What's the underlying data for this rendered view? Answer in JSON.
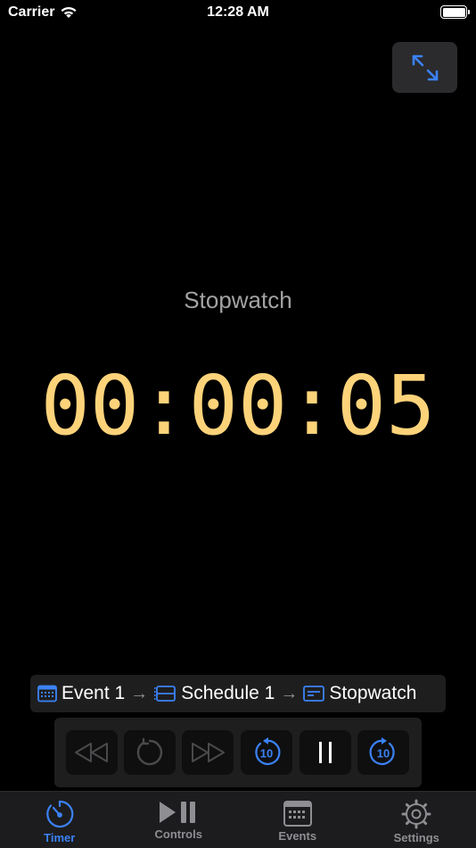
{
  "status_bar": {
    "carrier": "Carrier",
    "time": "12:28 AM"
  },
  "timer": {
    "mode": "Stopwatch",
    "display": "00:00:05"
  },
  "breadcrumb": {
    "event": "Event 1",
    "schedule": "Schedule 1",
    "timer": "Stopwatch"
  },
  "controls": {
    "skip_back_label": "10",
    "skip_forward_label": "10"
  },
  "tabs": [
    {
      "label": "Timer",
      "icon": "timer-icon",
      "active": true
    },
    {
      "label": "Controls",
      "icon": "play-pause-icon",
      "active": false
    },
    {
      "label": "Events",
      "icon": "calendar-icon",
      "active": false
    },
    {
      "label": "Settings",
      "icon": "gear-icon",
      "active": false
    }
  ],
  "colors": {
    "accent": "#3b82f6",
    "timer": "#fdd37a",
    "muted": "#8e8e93"
  }
}
